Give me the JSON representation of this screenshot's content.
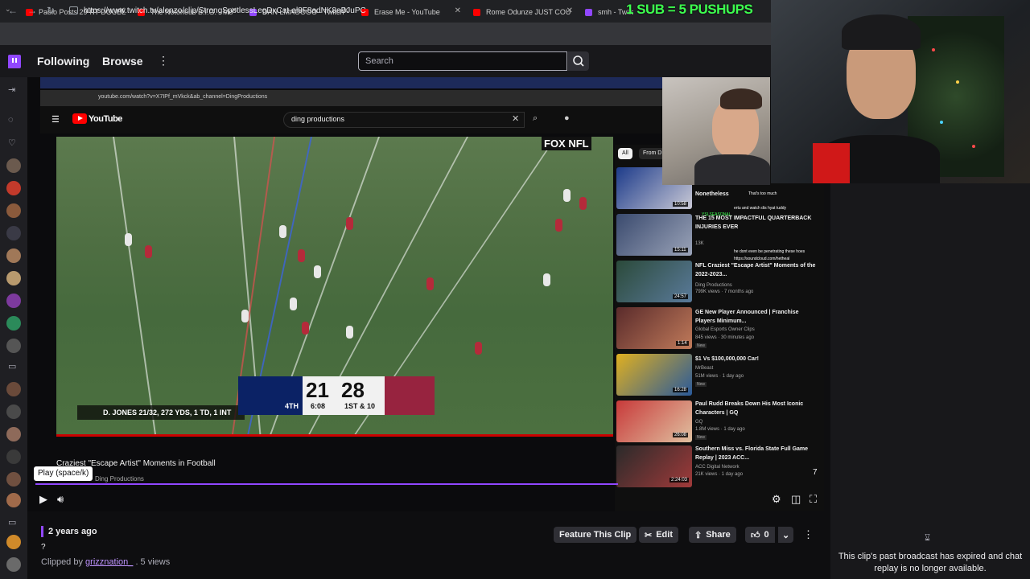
{
  "browser": {
    "tabs": [
      {
        "title": "Paolo Posts 29-PT DOUBL",
        "color": "#ff0000"
      },
      {
        "title": "The Notorious B.I.G. - Mo",
        "color": "#ff0000"
      },
      {
        "title": "DAN LMAOOOO - Twitch",
        "color": "#9147ff"
      },
      {
        "title": "Erase Me - YouTube",
        "color": "#ff0000"
      },
      {
        "title": "Rome Odunze JUST COU",
        "color": "#ff0000"
      },
      {
        "title": "smh - Twitc",
        "color": "#9147ff"
      }
    ],
    "url": "https://www.twitch.tv/alonzo/clip/StrongSpotlessLegDxCat-al8F8adNK8eBJuPC"
  },
  "overlay_text": "1 SUB = 5 PUSHUPS",
  "twitch_nav": {
    "following": "Following",
    "browse": "Browse",
    "more": "⋮",
    "search_placeholder": "Search"
  },
  "youtube": {
    "url": "youtube.com/watch?v=X7IPf_mVkck&ab_channel=DingProductions",
    "logo_text": "YouTube",
    "search_query": "ding productions",
    "video_title": "Craziest \"Escape Artist\" Moments in Football",
    "channel": "Ding Productions",
    "broadcast_logo": "FOX NFL",
    "scorebug": {
      "home_score": "21",
      "away_score": "28",
      "quarter": "4TH",
      "clock": "6:08",
      "down": "1ST & 10",
      "stat_line": "D. JONES 21/32, 272 YDS, 1 TD, 1 INT"
    },
    "chips": [
      "All",
      "From D"
    ],
    "recommendations": [
      {
        "title": "Nonetheless",
        "channel": "",
        "meta": "",
        "duration": "10:58",
        "is_new": false
      },
      {
        "title": "THE 15 MOST IMPACTFUL QUARTERBACK INJURIES EVER",
        "channel": "",
        "meta": "13K",
        "duration": "15:11",
        "is_new": false
      },
      {
        "title": "NFL Craziest \"Escape Artist\" Moments of the 2022-2023...",
        "channel": "Ding Productions",
        "meta": "799K views · 7 months ago",
        "duration": "24:57",
        "is_new": false
      },
      {
        "title": "GE New Player Announced | Franchise Players Minimum...",
        "channel": "Global Esports Owner Clips",
        "meta": "845 views · 30 minutes ago",
        "duration": "1:14",
        "is_new": true
      },
      {
        "title": "$1 Vs $100,000,000 Car!",
        "channel": "MrBeast",
        "meta": "51M views · 1 day ago",
        "duration": "16:28",
        "is_new": true
      },
      {
        "title": "Paul Rudd Breaks Down His Most Iconic Characters | GQ",
        "channel": "GQ",
        "meta": "1.8M views · 1 day ago",
        "duration": "26:08",
        "is_new": true
      },
      {
        "title": "Southern Miss vs. Florida State Full Game Replay | 2023 ACC...",
        "channel": "ACC Digital Network",
        "meta": "21K views · 1 day ago",
        "duration": "2:24:03",
        "is_new": true
      }
    ],
    "new_badge": "New",
    "chat_overlay_lines": [
      "That's too much",
      "ertu and watch dis hyat tuddy",
      "YSLSEASONAL",
      "https://soundcloud.com/hetheal",
      "he dont even be penetrating these hoes"
    ]
  },
  "player": {
    "tooltip": "Play (space/k)",
    "progress_fraction": 0.0,
    "viewer_count": "7"
  },
  "clip_info": {
    "age": "2 years ago",
    "title": "?",
    "clipped_by_label": "Clipped by",
    "clipper": "grizznation_",
    "views": ". 5 views"
  },
  "actions": {
    "feature": "Feature This Clip",
    "edit": "Edit",
    "share": "Share",
    "likes": "0",
    "more": "⋮"
  },
  "chat": {
    "message": "This clip's past broadcast has expired and chat replay is no longer available."
  },
  "colors": {
    "twitch_purple": "#9147ff",
    "twitch_bg": "#0e0e10",
    "promo_green": "#3dff4f"
  }
}
